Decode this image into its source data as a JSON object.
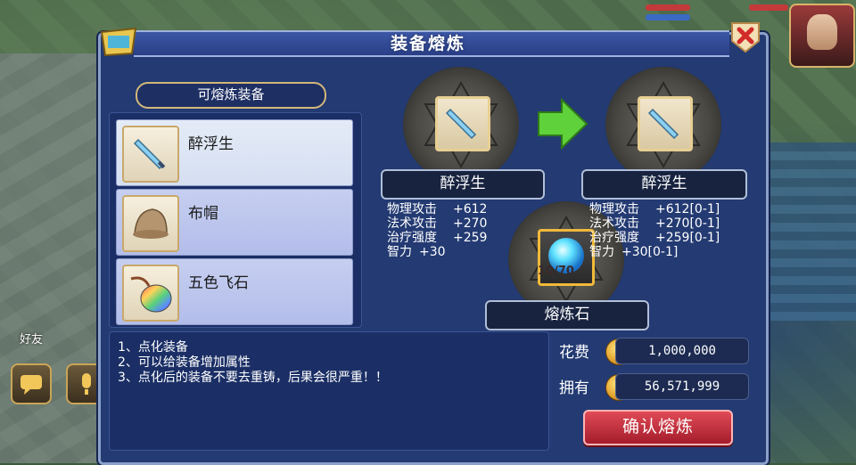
{
  "window": {
    "title": "装备熔炼"
  },
  "hud": {
    "friend_label": "好友"
  },
  "list": {
    "header": "可熔炼装备",
    "items": [
      {
        "name": "醉浮生",
        "icon": "dagger-icon"
      },
      {
        "name": "布帽",
        "icon": "cloth-hat-icon"
      },
      {
        "name": "五色飞石",
        "icon": "rainbow-stone-icon"
      }
    ]
  },
  "source": {
    "name": "醉浮生",
    "stats": [
      {
        "label": "物理攻击",
        "value": "+612"
      },
      {
        "label": "法术攻击",
        "value": "+270"
      },
      {
        "label": "治疗强度",
        "value": "+259"
      },
      {
        "label": "智力",
        "value": "+30"
      }
    ]
  },
  "result": {
    "name": "醉浮生",
    "stats": [
      {
        "label": "物理攻击",
        "value": "+612[0-1]"
      },
      {
        "label": "法术攻击",
        "value": "+270[0-1]"
      },
      {
        "label": "治疗强度",
        "value": "+259[0-1]"
      },
      {
        "label": "智力",
        "value": "+30[0-1]"
      }
    ]
  },
  "material": {
    "name": "熔炼石",
    "count": "10/70"
  },
  "description": [
    "1、点化装备",
    "2、可以给装备增加属性",
    "3、点化后的装备不要去重铸，后果会很严重！！"
  ],
  "cost": {
    "label": "花费",
    "value": "1,000,000"
  },
  "owned": {
    "label": "拥有",
    "value": "56,571,999"
  },
  "confirm_label": "确认熔炼",
  "colors": {
    "panel": "#233a72",
    "confirm": "#c52a3a",
    "accent": "#d2b77a"
  }
}
